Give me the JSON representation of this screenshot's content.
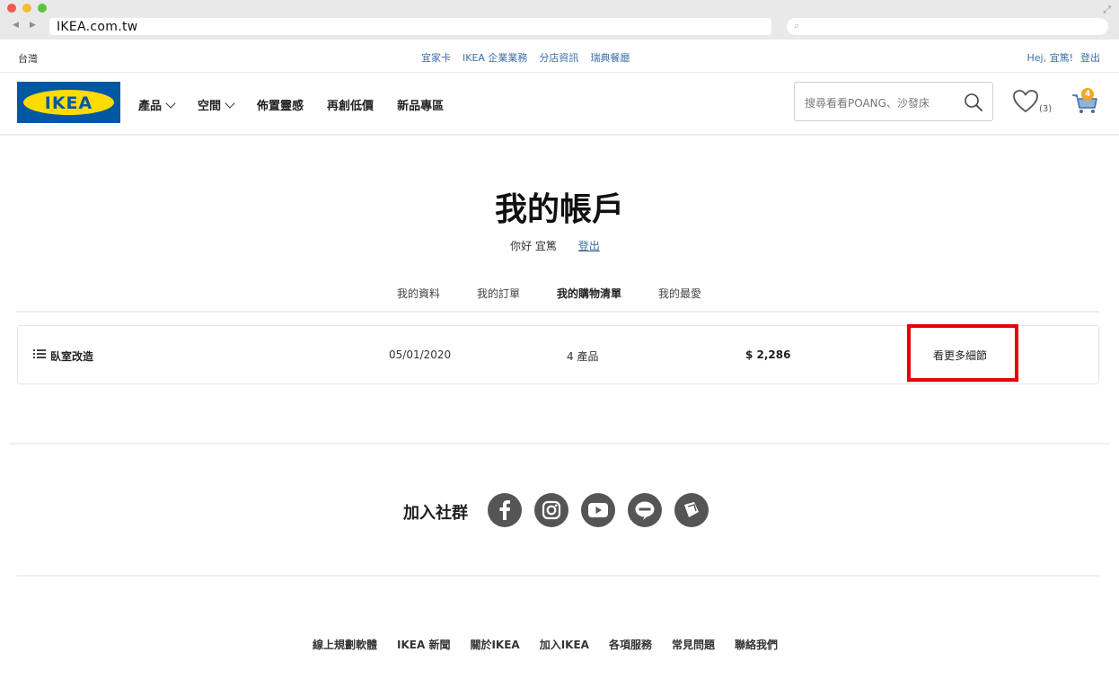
{
  "browser": {
    "url": "IKEA.com.tw",
    "back_glyph": "◀",
    "forward_glyph": "▶"
  },
  "topbar": {
    "region": "台灣",
    "links": [
      "宜家卡",
      "IKEA 企業業務",
      "分店資訊",
      "瑞典餐廳"
    ],
    "user_greeting": "Hej, 宜篤!",
    "logout": "登出"
  },
  "nav": {
    "logo_text": "IKEA",
    "items": [
      {
        "label": "產品",
        "has_dropdown": true
      },
      {
        "label": "空間",
        "has_dropdown": true
      },
      {
        "label": "佈置靈感",
        "has_dropdown": false
      },
      {
        "label": "再創低價",
        "has_dropdown": false
      },
      {
        "label": "新品專區",
        "has_dropdown": false
      }
    ],
    "search_placeholder": "搜尋看看POANG、沙發床",
    "wishlist_count": "(3)",
    "cart_count": "4"
  },
  "account": {
    "title": "我的帳戶",
    "greeting": "你好 宜篤",
    "logout_link": "登出",
    "tabs": [
      {
        "label": "我的資料",
        "active": false
      },
      {
        "label": "我的訂單",
        "active": false
      },
      {
        "label": "我的購物清單",
        "active": true
      },
      {
        "label": "我的最愛",
        "active": false
      }
    ],
    "shopping_list": {
      "name": "臥室改造",
      "date": "05/01/2020",
      "product_count": "4 產品",
      "price": "$ 2,286",
      "details_link": "看更多細節"
    }
  },
  "social": {
    "title": "加入社群",
    "icons": [
      "facebook-icon",
      "instagram-icon",
      "youtube-icon",
      "line-icon",
      "other-social-icon"
    ]
  },
  "footer": {
    "links": [
      "線上規劃軟體",
      "IKEA 新聞",
      "關於IKEA",
      "加入IKEA",
      "各項服務",
      "常見問題",
      "聯絡我們"
    ]
  },
  "colors": {
    "ikea_blue": "#0058a3",
    "ikea_yellow": "#ffdb00",
    "link_blue": "#3c6fa8",
    "highlight_red": "#e8000a"
  }
}
